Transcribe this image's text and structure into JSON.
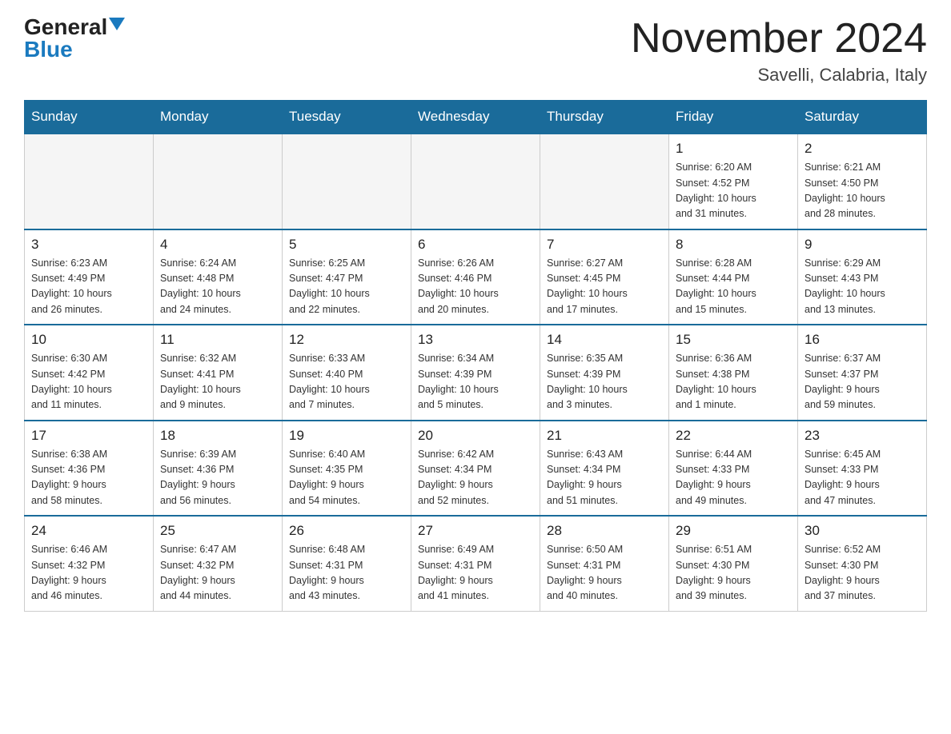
{
  "header": {
    "logo_general": "General",
    "logo_blue": "Blue",
    "title": "November 2024",
    "subtitle": "Savelli, Calabria, Italy"
  },
  "days_of_week": [
    "Sunday",
    "Monday",
    "Tuesday",
    "Wednesday",
    "Thursday",
    "Friday",
    "Saturday"
  ],
  "weeks": [
    [
      {
        "day": "",
        "info": ""
      },
      {
        "day": "",
        "info": ""
      },
      {
        "day": "",
        "info": ""
      },
      {
        "day": "",
        "info": ""
      },
      {
        "day": "",
        "info": ""
      },
      {
        "day": "1",
        "info": "Sunrise: 6:20 AM\nSunset: 4:52 PM\nDaylight: 10 hours\nand 31 minutes."
      },
      {
        "day": "2",
        "info": "Sunrise: 6:21 AM\nSunset: 4:50 PM\nDaylight: 10 hours\nand 28 minutes."
      }
    ],
    [
      {
        "day": "3",
        "info": "Sunrise: 6:23 AM\nSunset: 4:49 PM\nDaylight: 10 hours\nand 26 minutes."
      },
      {
        "day": "4",
        "info": "Sunrise: 6:24 AM\nSunset: 4:48 PM\nDaylight: 10 hours\nand 24 minutes."
      },
      {
        "day": "5",
        "info": "Sunrise: 6:25 AM\nSunset: 4:47 PM\nDaylight: 10 hours\nand 22 minutes."
      },
      {
        "day": "6",
        "info": "Sunrise: 6:26 AM\nSunset: 4:46 PM\nDaylight: 10 hours\nand 20 minutes."
      },
      {
        "day": "7",
        "info": "Sunrise: 6:27 AM\nSunset: 4:45 PM\nDaylight: 10 hours\nand 17 minutes."
      },
      {
        "day": "8",
        "info": "Sunrise: 6:28 AM\nSunset: 4:44 PM\nDaylight: 10 hours\nand 15 minutes."
      },
      {
        "day": "9",
        "info": "Sunrise: 6:29 AM\nSunset: 4:43 PM\nDaylight: 10 hours\nand 13 minutes."
      }
    ],
    [
      {
        "day": "10",
        "info": "Sunrise: 6:30 AM\nSunset: 4:42 PM\nDaylight: 10 hours\nand 11 minutes."
      },
      {
        "day": "11",
        "info": "Sunrise: 6:32 AM\nSunset: 4:41 PM\nDaylight: 10 hours\nand 9 minutes."
      },
      {
        "day": "12",
        "info": "Sunrise: 6:33 AM\nSunset: 4:40 PM\nDaylight: 10 hours\nand 7 minutes."
      },
      {
        "day": "13",
        "info": "Sunrise: 6:34 AM\nSunset: 4:39 PM\nDaylight: 10 hours\nand 5 minutes."
      },
      {
        "day": "14",
        "info": "Sunrise: 6:35 AM\nSunset: 4:39 PM\nDaylight: 10 hours\nand 3 minutes."
      },
      {
        "day": "15",
        "info": "Sunrise: 6:36 AM\nSunset: 4:38 PM\nDaylight: 10 hours\nand 1 minute."
      },
      {
        "day": "16",
        "info": "Sunrise: 6:37 AM\nSunset: 4:37 PM\nDaylight: 9 hours\nand 59 minutes."
      }
    ],
    [
      {
        "day": "17",
        "info": "Sunrise: 6:38 AM\nSunset: 4:36 PM\nDaylight: 9 hours\nand 58 minutes."
      },
      {
        "day": "18",
        "info": "Sunrise: 6:39 AM\nSunset: 4:36 PM\nDaylight: 9 hours\nand 56 minutes."
      },
      {
        "day": "19",
        "info": "Sunrise: 6:40 AM\nSunset: 4:35 PM\nDaylight: 9 hours\nand 54 minutes."
      },
      {
        "day": "20",
        "info": "Sunrise: 6:42 AM\nSunset: 4:34 PM\nDaylight: 9 hours\nand 52 minutes."
      },
      {
        "day": "21",
        "info": "Sunrise: 6:43 AM\nSunset: 4:34 PM\nDaylight: 9 hours\nand 51 minutes."
      },
      {
        "day": "22",
        "info": "Sunrise: 6:44 AM\nSunset: 4:33 PM\nDaylight: 9 hours\nand 49 minutes."
      },
      {
        "day": "23",
        "info": "Sunrise: 6:45 AM\nSunset: 4:33 PM\nDaylight: 9 hours\nand 47 minutes."
      }
    ],
    [
      {
        "day": "24",
        "info": "Sunrise: 6:46 AM\nSunset: 4:32 PM\nDaylight: 9 hours\nand 46 minutes."
      },
      {
        "day": "25",
        "info": "Sunrise: 6:47 AM\nSunset: 4:32 PM\nDaylight: 9 hours\nand 44 minutes."
      },
      {
        "day": "26",
        "info": "Sunrise: 6:48 AM\nSunset: 4:31 PM\nDaylight: 9 hours\nand 43 minutes."
      },
      {
        "day": "27",
        "info": "Sunrise: 6:49 AM\nSunset: 4:31 PM\nDaylight: 9 hours\nand 41 minutes."
      },
      {
        "day": "28",
        "info": "Sunrise: 6:50 AM\nSunset: 4:31 PM\nDaylight: 9 hours\nand 40 minutes."
      },
      {
        "day": "29",
        "info": "Sunrise: 6:51 AM\nSunset: 4:30 PM\nDaylight: 9 hours\nand 39 minutes."
      },
      {
        "day": "30",
        "info": "Sunrise: 6:52 AM\nSunset: 4:30 PM\nDaylight: 9 hours\nand 37 minutes."
      }
    ]
  ]
}
